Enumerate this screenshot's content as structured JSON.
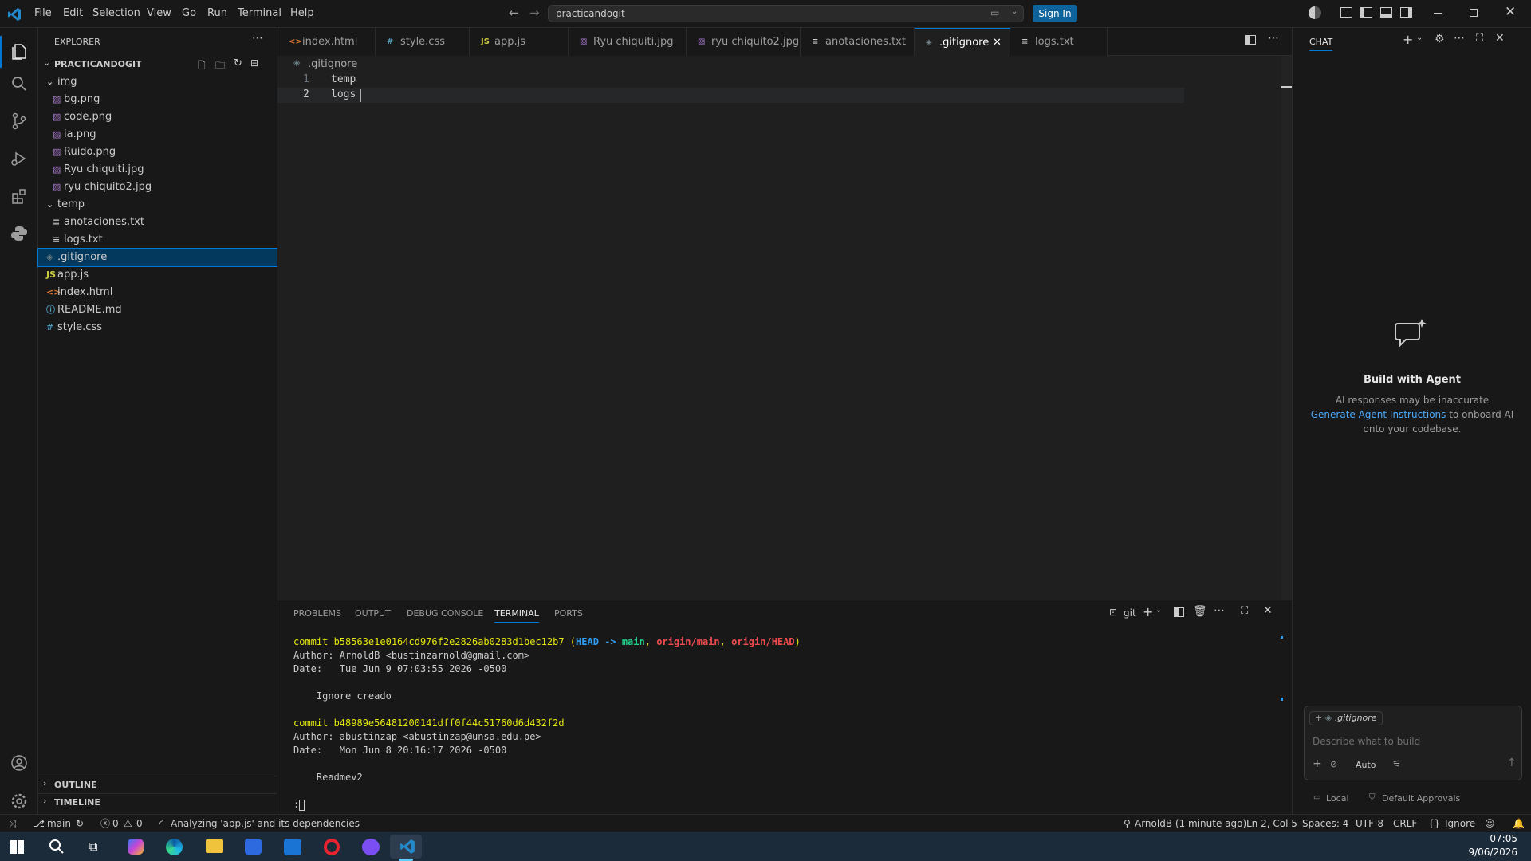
{
  "titlebar": {
    "menus": [
      "File",
      "Edit",
      "Selection",
      "View",
      "Go",
      "Run",
      "Terminal",
      "Help"
    ],
    "search": "practicandogit",
    "signin": "Sign In"
  },
  "sidebar": {
    "title": "EXPLORER",
    "project": "PRACTICANDOGIT",
    "tree": [
      {
        "label": "img",
        "type": "folder",
        "depth": 1
      },
      {
        "label": "bg.png",
        "type": "image",
        "depth": 2
      },
      {
        "label": "code.png",
        "type": "image",
        "depth": 2
      },
      {
        "label": "ia.png",
        "type": "image",
        "depth": 2
      },
      {
        "label": "Ruido.png",
        "type": "image",
        "depth": 2
      },
      {
        "label": "Ryu chiquiti.jpg",
        "type": "image",
        "depth": 2
      },
      {
        "label": "ryu chiquito2.jpg",
        "type": "image",
        "depth": 2
      },
      {
        "label": "temp",
        "type": "folder",
        "depth": 1
      },
      {
        "label": "anotaciones.txt",
        "type": "text",
        "depth": 2
      },
      {
        "label": "logs.txt",
        "type": "text",
        "depth": 2
      },
      {
        "label": ".gitignore",
        "type": "git",
        "depth": 1,
        "selected": true
      },
      {
        "label": "app.js",
        "type": "js",
        "depth": 1
      },
      {
        "label": "index.html",
        "type": "html",
        "depth": 1
      },
      {
        "label": "README.md",
        "type": "info",
        "depth": 1
      },
      {
        "label": "style.css",
        "type": "css",
        "depth": 1
      }
    ],
    "outline": "OUTLINE",
    "timeline": "TIMELINE"
  },
  "tabs": [
    {
      "label": "index.html",
      "icon": "<>",
      "color": "#e37933"
    },
    {
      "label": "style.css",
      "icon": "#",
      "color": "#519aba"
    },
    {
      "label": "app.js",
      "icon": "JS",
      "color": "#cbcb41"
    },
    {
      "label": "Ryu chiquiti.jpg",
      "icon": "img",
      "color": "#a074c4"
    },
    {
      "label": "ryu chiquito2.jpg",
      "icon": "img",
      "color": "#a074c4"
    },
    {
      "label": "anotaciones.txt",
      "icon": "txt",
      "color": "#cccccc"
    },
    {
      "label": ".gitignore",
      "icon": "git",
      "color": "#6d8086",
      "active": true
    },
    {
      "label": "logs.txt",
      "icon": "txt",
      "color": "#cccccc"
    }
  ],
  "editor": {
    "breadcrumb": ".gitignore",
    "lines": [
      {
        "n": "1",
        "text": "temp"
      },
      {
        "n": "2",
        "text": "logs"
      }
    ]
  },
  "panel": {
    "tabs": [
      "PROBLEMS",
      "OUTPUT",
      "DEBUG CONSOLE",
      "TERMINAL",
      "PORTS"
    ],
    "active_tab": "TERMINAL",
    "shell": "git",
    "commit1": {
      "hash": "commit b58563e1e0164cd976f2e2826ab0283d1bec12b7",
      "open": " (",
      "head": "HEAD",
      "arrow": " -> ",
      "main": "main",
      "sep1": ", ",
      "origin_main": "origin/main",
      "sep2": ", ",
      "origin_head": "origin/HEAD",
      "close": ")",
      "author": "Author: ArnoldB <bustinzarnold@gmail.com>",
      "date": "Date:   Tue Jun 9 07:03:55 2026 -0500",
      "message": "    Ignore creado"
    },
    "commit2": {
      "hash": "commit b48989e56481200141dff0f44c51760d6d432f2d",
      "author": "Author: abustinzap <abustinzap@unsa.edu.pe>",
      "date": "Date:   Mon Jun 8 20:16:17 2026 -0500",
      "message": "    Readmev2"
    },
    "prompt": ":"
  },
  "chat": {
    "title": "CHAT",
    "heading": "Build with Agent",
    "line1": "AI responses may be inaccurate",
    "link": "Generate Agent Instructions",
    "line2_suffix": " to onboard AI",
    "line3": "onto your codebase.",
    "context_file": ".gitignore",
    "placeholder": "Describe what to build",
    "mode": "Auto",
    "location": "Local",
    "approvals": "Default Approvals"
  },
  "statusbar": {
    "branch": "main",
    "errors": "0",
    "warnings": "0",
    "analyzing": "Analyzing 'app.js' and its dependencies",
    "blame": "ArnoldB (1 minute ago)",
    "position": "Ln 2, Col 5",
    "spaces": "Spaces: 4",
    "encoding": "UTF-8",
    "eol": "CRLF",
    "language": "Ignore"
  },
  "taskbar": {
    "time": "07:05",
    "date": "9/06/2026"
  }
}
